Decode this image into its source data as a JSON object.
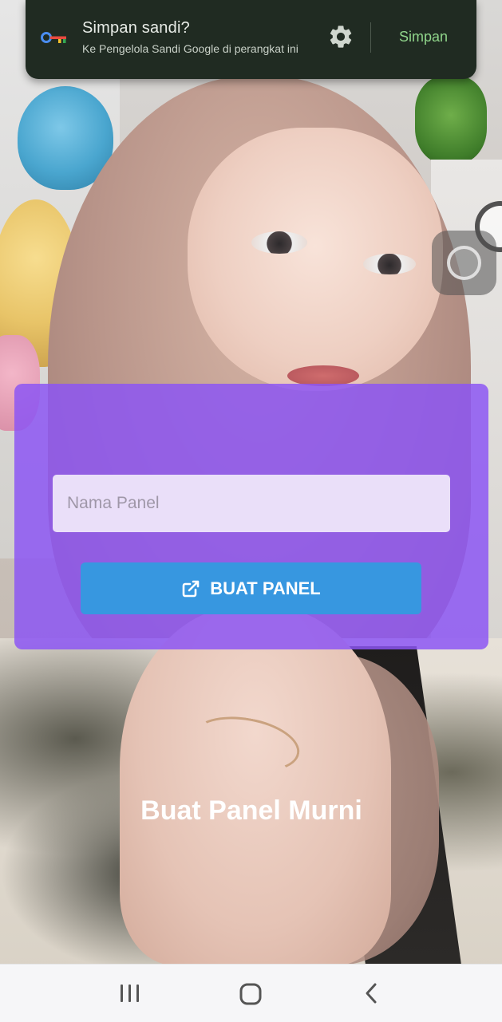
{
  "autofill_prompt": {
    "title": "Simpan sandi?",
    "subtitle": "Ke Pengelola Sandi Google di perangkat ini",
    "save_label": "Simpan",
    "key_icon": "password-key-icon",
    "settings_icon": "gear-icon"
  },
  "panel_form": {
    "title": "Buat Panel Murni",
    "name_input": {
      "placeholder": "Nama Panel",
      "value": ""
    },
    "submit_label": "BUAT PANEL",
    "submit_icon": "external-link-icon"
  },
  "nav_bar": {
    "recents_icon": "recents-icon",
    "home_icon": "home-icon",
    "back_icon": "back-icon"
  },
  "colors": {
    "prompt_bg": "#202b22",
    "prompt_accent": "#8fd48a",
    "card_bg": "#8c55f4",
    "input_bg": "#eadff9",
    "button_bg": "#3797e0"
  }
}
